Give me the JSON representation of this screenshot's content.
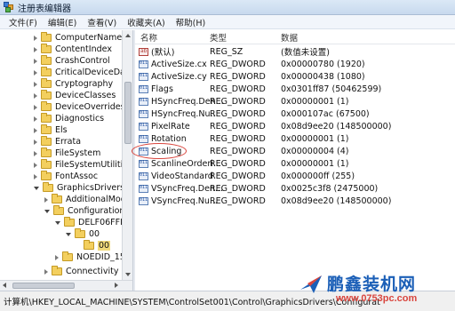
{
  "window": {
    "title": "注册表编辑器"
  },
  "menu": [
    "文件(F)",
    "编辑(E)",
    "查看(V)",
    "收藏夹(A)",
    "帮助(H)"
  ],
  "tree": [
    {
      "label": "ComputerName",
      "icon": "folder-icon"
    },
    {
      "label": "ContentIndex",
      "icon": "folder-icon"
    },
    {
      "label": "CrashControl",
      "icon": "folder-icon"
    },
    {
      "label": "CriticalDeviceDatab",
      "icon": "folder-icon"
    },
    {
      "label": "Cryptography",
      "icon": "folder-icon"
    },
    {
      "label": "DeviceClasses",
      "icon": "folder-icon"
    },
    {
      "label": "DeviceOverrides",
      "icon": "folder-icon"
    },
    {
      "label": "Diagnostics",
      "icon": "folder-icon"
    },
    {
      "label": "Els",
      "icon": "folder-icon"
    },
    {
      "label": "Errata",
      "icon": "folder-icon"
    },
    {
      "label": "FileSystem",
      "icon": "folder-icon"
    },
    {
      "label": "FileSystemUtilities",
      "icon": "folder-icon"
    },
    {
      "label": "FontAssoc",
      "icon": "folder-icon"
    },
    {
      "label": "GraphicsDrivers",
      "icon": "folder-icon"
    },
    {
      "label": "AdditionalMode",
      "icon": "folder-icon"
    },
    {
      "label": "Configuration",
      "icon": "folder-icon"
    },
    {
      "label": "DELF06FFFW",
      "icon": "folder-icon"
    },
    {
      "label": "00",
      "icon": "folder-icon"
    },
    {
      "label": "00",
      "icon": "folder-icon",
      "selected": true
    },
    {
      "label": "NOEDID_154",
      "icon": "folder-icon"
    },
    {
      "label": "Connectivity",
      "icon": "folder-icon"
    }
  ],
  "values_pane": {
    "headers": {
      "name": "名称",
      "type": "类型",
      "data": "数据"
    },
    "rows": [
      {
        "name": "(默认)",
        "type": "REG_SZ",
        "data": "(数值未设置)",
        "icon": "string-value-icon"
      },
      {
        "name": "ActiveSize.cx",
        "type": "REG_DWORD",
        "data": "0x00000780 (1920)",
        "icon": "binary-value-icon"
      },
      {
        "name": "ActiveSize.cy",
        "type": "REG_DWORD",
        "data": "0x00000438 (1080)",
        "icon": "binary-value-icon"
      },
      {
        "name": "Flags",
        "type": "REG_DWORD",
        "data": "0x0301ff87 (50462599)",
        "icon": "binary-value-icon"
      },
      {
        "name": "HSyncFreq.Den...",
        "type": "REG_DWORD",
        "data": "0x00000001 (1)",
        "icon": "binary-value-icon"
      },
      {
        "name": "HSyncFreq.Nu...",
        "type": "REG_DWORD",
        "data": "0x000107ac (67500)",
        "icon": "binary-value-icon"
      },
      {
        "name": "PixelRate",
        "type": "REG_DWORD",
        "data": "0x08d9ee20 (148500000)",
        "icon": "binary-value-icon"
      },
      {
        "name": "Rotation",
        "type": "REG_DWORD",
        "data": "0x00000001 (1)",
        "icon": "binary-value-icon"
      },
      {
        "name": "Scaling",
        "type": "REG_DWORD",
        "data": "0x00000004 (4)",
        "icon": "binary-value-icon",
        "highlighted": true
      },
      {
        "name": "ScanlineOrderi...",
        "type": "REG_DWORD",
        "data": "0x00000001 (1)",
        "icon": "binary-value-icon"
      },
      {
        "name": "VideoStandard",
        "type": "REG_DWORD",
        "data": "0x000000ff (255)",
        "icon": "binary-value-icon"
      },
      {
        "name": "VSyncFreq.Den...",
        "type": "REG_DWORD",
        "data": "0x0025c3f8 (2475000)",
        "icon": "binary-value-icon"
      },
      {
        "name": "VSyncFreq.Nu...",
        "type": "REG_DWORD",
        "data": "0x08d9ee20 (148500000)",
        "icon": "binary-value-icon"
      }
    ]
  },
  "status_bar": {
    "path": "计算机\\HKEY_LOCAL_MACHINE\\SYSTEM\\ControlSet001\\Control\\GraphicsDrivers\\Configurat"
  },
  "watermark": {
    "brand": "鹏鑫装机网",
    "url": "www.0753pc.com"
  },
  "colors": {
    "highlight_circle": "#d9463e",
    "selected_folder": "#f0d97a",
    "watermark_blue": "#1b5fb7",
    "watermark_red": "#d9463e"
  }
}
